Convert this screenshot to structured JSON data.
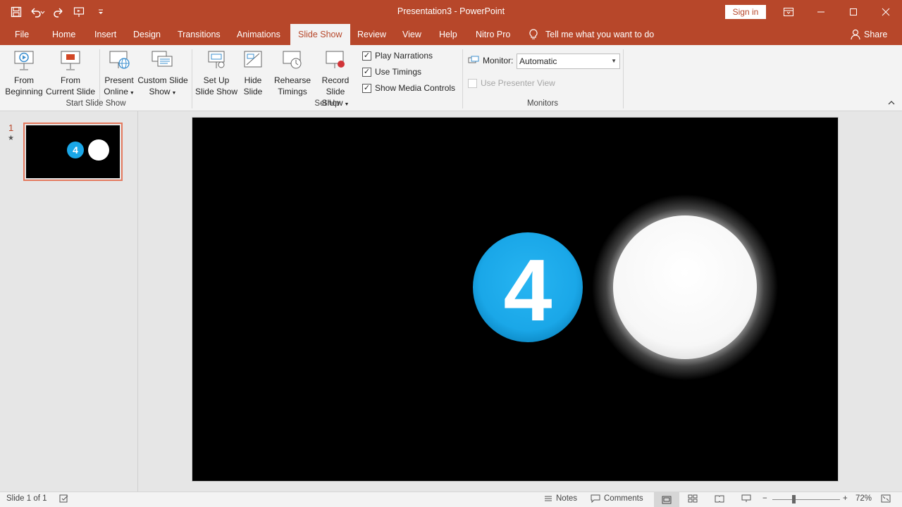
{
  "window": {
    "title": "Presentation3  -  PowerPoint",
    "sign_in": "Sign in",
    "share": "Share",
    "tell_me": "Tell me what you want to do",
    "accent": "#b7472a"
  },
  "tabs": [
    "File",
    "Home",
    "Insert",
    "Design",
    "Transitions",
    "Animations",
    "Slide Show",
    "Review",
    "View",
    "Help",
    "Nitro Pro"
  ],
  "active_tab": "Slide Show",
  "ribbon": {
    "start": {
      "label": "Start Slide Show",
      "from_beginning": [
        "From",
        "Beginning"
      ],
      "from_current": [
        "From",
        "Current Slide"
      ],
      "present_online": [
        "Present",
        "Online"
      ],
      "custom_show": [
        "Custom Slide",
        "Show"
      ]
    },
    "setup": {
      "label": "Set Up",
      "setup_show": [
        "Set Up",
        "Slide Show"
      ],
      "hide_slide": [
        "Hide",
        "Slide"
      ],
      "rehearse": [
        "Rehearse",
        "Timings"
      ],
      "record": [
        "Record Slide",
        "Show"
      ],
      "play_narrations": "Play Narrations",
      "use_timings": "Use Timings",
      "show_media_controls": "Show Media Controls"
    },
    "monitors": {
      "label": "Monitors",
      "monitor": "Monitor:",
      "monitor_value": "Automatic",
      "presenter_view": "Use Presenter View"
    }
  },
  "thumbnail": {
    "number": "1",
    "star": "★"
  },
  "slide": {
    "badge_number": "4",
    "badge_color": "#1aa7e8"
  },
  "status": {
    "slide_info": "Slide 1 of 1",
    "notes": "Notes",
    "comments": "Comments",
    "zoom": "72%",
    "zoom_out": "−",
    "zoom_in": "+"
  }
}
